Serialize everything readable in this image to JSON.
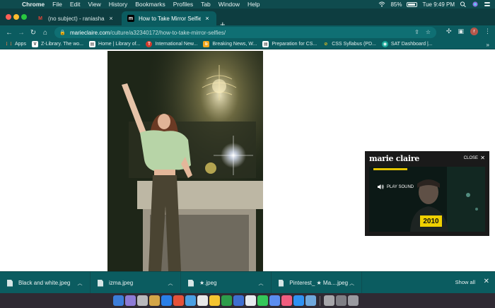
{
  "menubar": {
    "app": "Chrome",
    "items": [
      "File",
      "Edit",
      "View",
      "History",
      "Bookmarks",
      "Profiles",
      "Tab",
      "Window",
      "Help"
    ],
    "battery": "85%",
    "clock": "Tue 9:49 PM"
  },
  "tabs": [
    {
      "title": "(no subject) - raniashahid09@",
      "favicon": "gmail-icon"
    },
    {
      "title": "How to Take Mirror Selfies | Ti",
      "favicon": "marie-claire-icon"
    }
  ],
  "address": {
    "host": "marieclaire.com",
    "path": "/culture/a32340172/how-to-take-mirror-selfies/"
  },
  "bookmarks": [
    {
      "label": "Apps",
      "color": "#e8804a"
    },
    {
      "label": "Z-Library. The wo...",
      "color": "#ffffff"
    },
    {
      "label": "Home | Library of...",
      "color": "#ffffff"
    },
    {
      "label": "International New...",
      "color": "#d33a2c"
    },
    {
      "label": "Breaking News, W...",
      "color": "#f2a71b"
    },
    {
      "label": "Preparation for CS...",
      "color": "#ffffff"
    },
    {
      "label": "CSS Syllabus (PD...",
      "color": "#f2c41b"
    },
    {
      "label": "SAT Dashboard |...",
      "color": "#1ba89a"
    }
  ],
  "video": {
    "brand": "marie claire",
    "close_label": "CLOSE",
    "play_sound": "PLAY SOUND",
    "year": "2010"
  },
  "downloads": {
    "items": [
      "Black and white.jpeg",
      "izma.jpeg",
      "★.jpeg",
      "Pinterest_ ★ Ma....jpeg"
    ],
    "show_all": "Show all"
  },
  "dock": {
    "colors": [
      "#3c7dd9",
      "#8d7bd6",
      "#b8b8bc",
      "#d3a548",
      "#2a7fe8",
      "#e6523a",
      "#4aa0e3",
      "#e8e8e8",
      "#f4c431",
      "#2d9d4a",
      "#3f6fd1",
      "#e7ebef",
      "#34c759",
      "#5b8def",
      "#f05d7f",
      "#2f92f2",
      "#6fa8dc",
      "#a6a6aa",
      "#7f7f85",
      "#9a9aa0"
    ]
  }
}
